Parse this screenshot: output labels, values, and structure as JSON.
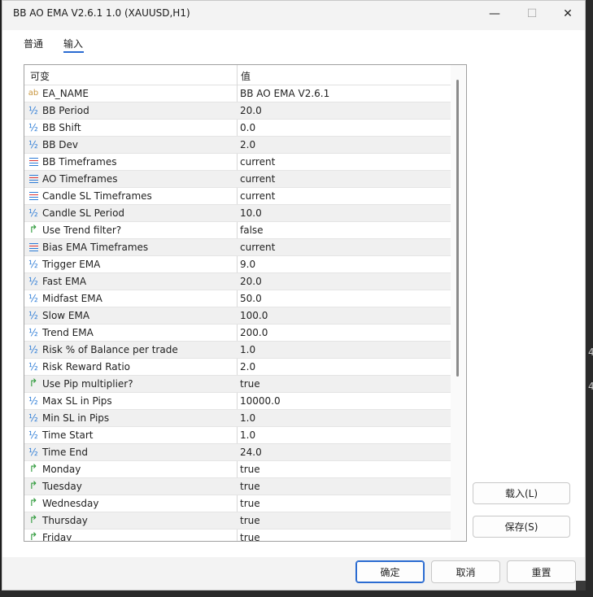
{
  "window": {
    "title": "BB AO EMA V2.6.1 1.0 (XAUUSD,H1)",
    "minimize": "—",
    "maximize": "☐",
    "close": "✕"
  },
  "tabs": [
    {
      "label": "普通"
    },
    {
      "label": "输入"
    }
  ],
  "grid": {
    "col_variable": "可变",
    "col_value": "值",
    "rows": [
      {
        "icon": "ab",
        "name": "EA_NAME",
        "value": "BB AO EMA V2.6.1"
      },
      {
        "icon": "½",
        "name": "BB Period",
        "value": "20.0"
      },
      {
        "icon": "½",
        "name": "BB Shift",
        "value": "0.0"
      },
      {
        "icon": "½",
        "name": "BB Dev",
        "value": "2.0"
      },
      {
        "icon": "enum",
        "name": "BB Timeframes",
        "value": "current"
      },
      {
        "icon": "enum",
        "name": "AO Timeframes",
        "value": "current"
      },
      {
        "icon": "enum",
        "name": "Candle SL Timeframes",
        "value": "current"
      },
      {
        "icon": "½",
        "name": "Candle SL Period",
        "value": "10.0"
      },
      {
        "icon": "bool",
        "name": "Use Trend filter?",
        "value": "false"
      },
      {
        "icon": "enum",
        "name": "Bias EMA Timeframes",
        "value": "current"
      },
      {
        "icon": "½",
        "name": "Trigger EMA",
        "value": "9.0"
      },
      {
        "icon": "½",
        "name": "Fast EMA",
        "value": "20.0"
      },
      {
        "icon": "½",
        "name": "Midfast EMA",
        "value": "50.0"
      },
      {
        "icon": "½",
        "name": "Slow EMA",
        "value": "100.0"
      },
      {
        "icon": "½",
        "name": "Trend EMA",
        "value": "200.0"
      },
      {
        "icon": "½",
        "name": "Risk % of Balance per trade",
        "value": "1.0"
      },
      {
        "icon": "½",
        "name": "Risk Reward Ratio",
        "value": "2.0"
      },
      {
        "icon": "bool",
        "name": "Use Pip multiplier?",
        "value": "true"
      },
      {
        "icon": "½",
        "name": "Max SL in Pips",
        "value": "10000.0"
      },
      {
        "icon": "½",
        "name": "Min SL in Pips",
        "value": "1.0"
      },
      {
        "icon": "½",
        "name": "Time Start",
        "value": "1.0"
      },
      {
        "icon": "½",
        "name": "Time End",
        "value": "24.0"
      },
      {
        "icon": "bool",
        "name": "Monday",
        "value": "true"
      },
      {
        "icon": "bool",
        "name": "Tuesday",
        "value": "true"
      },
      {
        "icon": "bool",
        "name": "Wednesday",
        "value": "true"
      },
      {
        "icon": "bool",
        "name": "Thursday",
        "value": "true"
      },
      {
        "icon": "bool",
        "name": "Friday",
        "value": "true"
      }
    ]
  },
  "side_buttons": {
    "load": "载入(L)",
    "save": "保存(S)"
  },
  "footer": {
    "ok": "确定",
    "cancel": "取消",
    "reset": "重置"
  },
  "background_edge": {
    "text1": "4",
    "text2": "4"
  }
}
